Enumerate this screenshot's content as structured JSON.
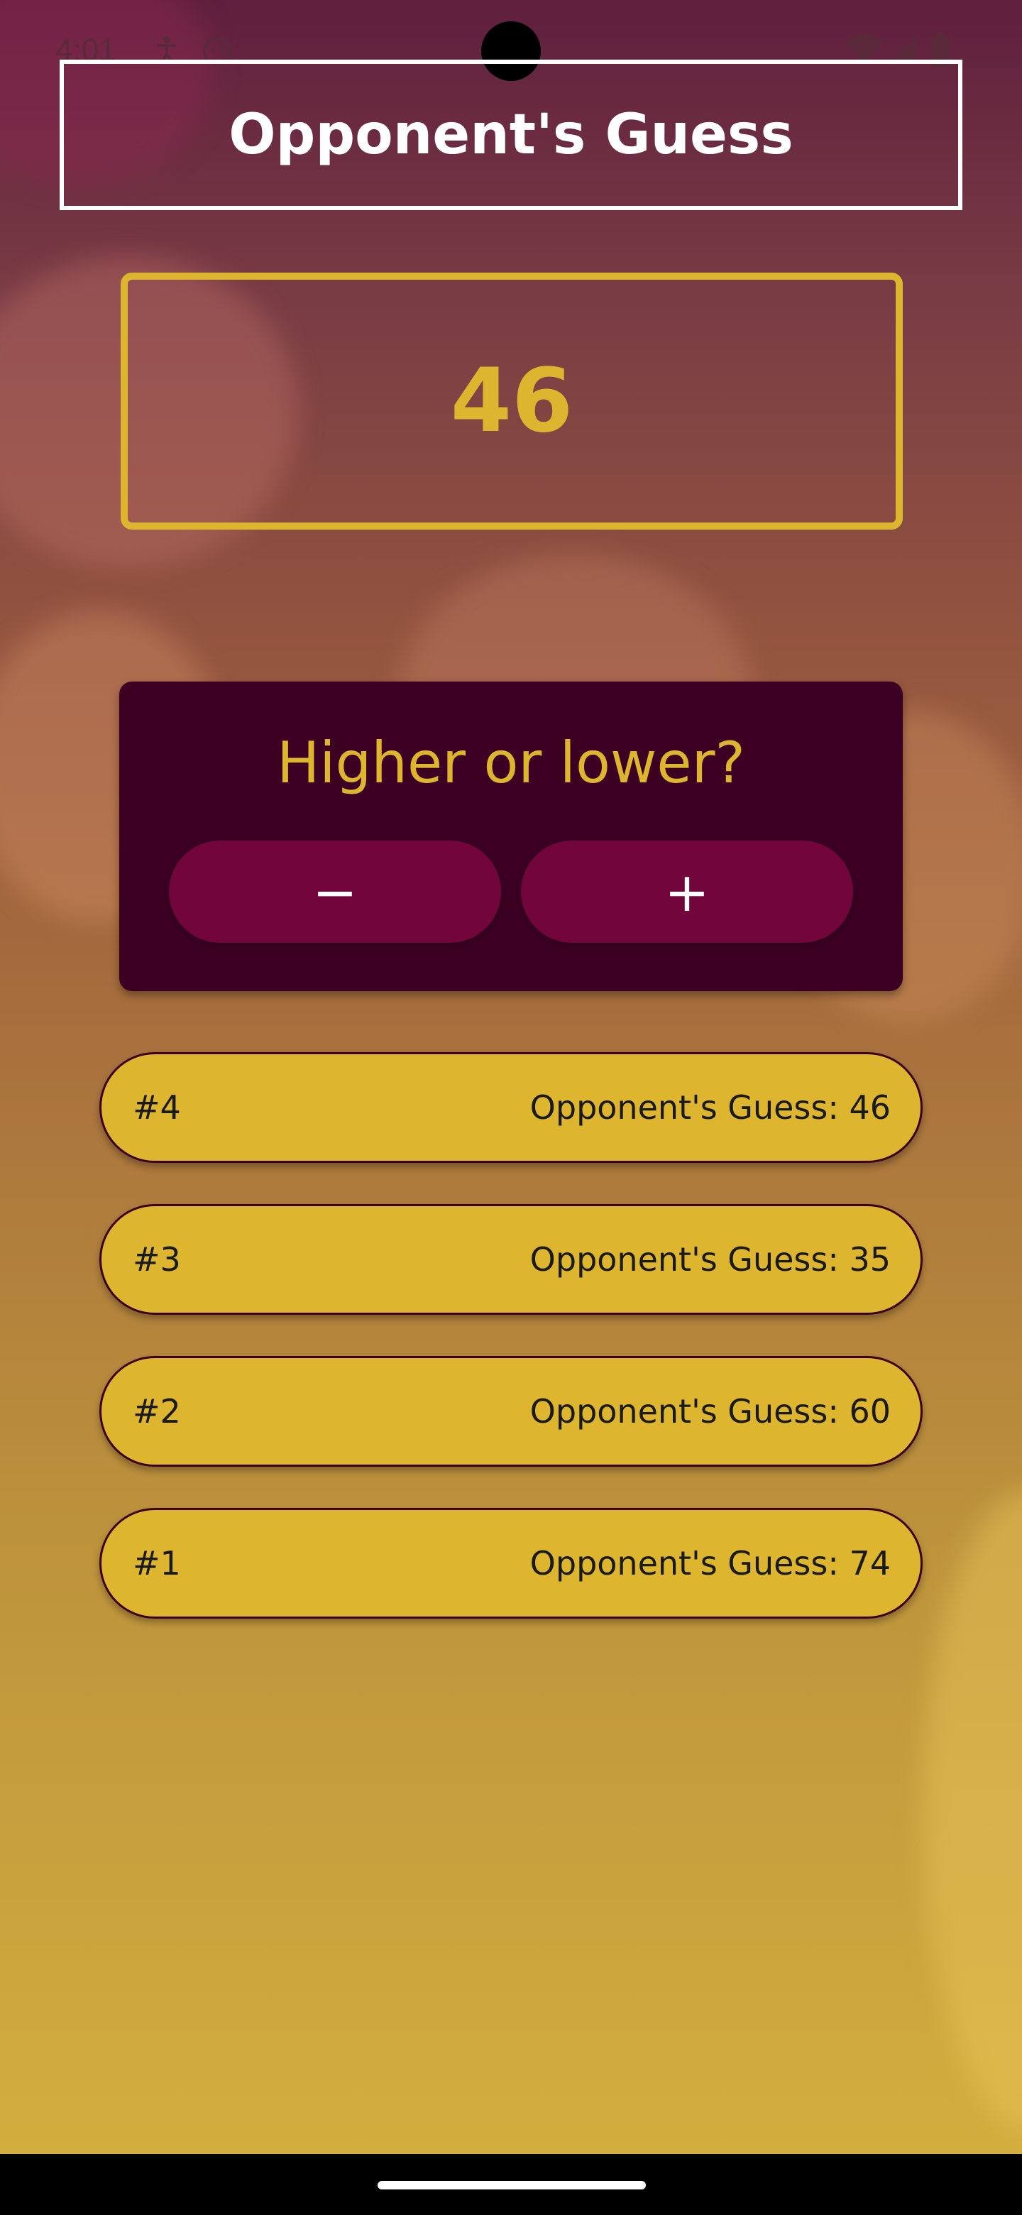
{
  "status_bar": {
    "time": "4:01"
  },
  "title": "Opponent's Guess",
  "current_guess": "46",
  "prompt": {
    "question": "Higher or lower?",
    "minus_label": "−",
    "plus_label": "+"
  },
  "rounds": [
    {
      "number": "#4",
      "text": "Opponent's Guess: 46"
    },
    {
      "number": "#3",
      "text": "Opponent's Guess: 35"
    },
    {
      "number": "#2",
      "text": "Opponent's Guess: 60"
    },
    {
      "number": "#1",
      "text": "Opponent's Guess: 74"
    }
  ],
  "colors": {
    "accent": "#ddb52f",
    "card": "#3b0022",
    "button": "#72063c",
    "title": "#ffffff"
  }
}
